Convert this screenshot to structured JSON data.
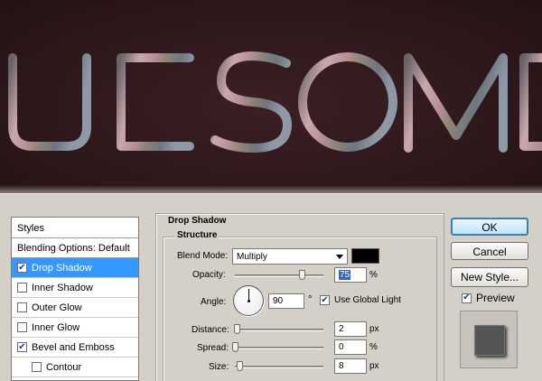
{
  "canvas": {
    "word": "WESOME"
  },
  "styles_panel": {
    "header": "Styles",
    "items": [
      {
        "label": "Blending Options: Default",
        "checkbox": false,
        "checked": false,
        "selected": false
      },
      {
        "label": "Drop Shadow",
        "checkbox": true,
        "checked": true,
        "selected": true
      },
      {
        "label": "Inner Shadow",
        "checkbox": true,
        "checked": false,
        "selected": false
      },
      {
        "label": "Outer Glow",
        "checkbox": true,
        "checked": false,
        "selected": false
      },
      {
        "label": "Inner Glow",
        "checkbox": true,
        "checked": false,
        "selected": false
      },
      {
        "label": "Bevel and Emboss",
        "checkbox": true,
        "checked": true,
        "selected": false
      },
      {
        "label": "Contour",
        "checkbox": true,
        "checked": false,
        "selected": false
      }
    ]
  },
  "drop_shadow": {
    "title": "Drop Shadow",
    "structure_title": "Structure",
    "blend_mode": {
      "label": "Blend Mode:",
      "value": "Multiply",
      "color": "#000000"
    },
    "opacity": {
      "label": "Opacity:",
      "value": "75",
      "unit": "%",
      "slider_fraction": 0.75
    },
    "angle": {
      "label": "Angle:",
      "value": "90",
      "unit": "°",
      "use_global_light_label": "Use Global Light",
      "use_global_light": true
    },
    "distance": {
      "label": "Distance:",
      "value": "2",
      "unit": "px",
      "slider_fraction": 0.0
    },
    "spread": {
      "label": "Spread:",
      "value": "0",
      "unit": "%",
      "slider_fraction": 0.0
    },
    "size": {
      "label": "Size:",
      "value": "8",
      "unit": "px",
      "slider_fraction": 0.05
    }
  },
  "buttons": {
    "ok": "OK",
    "cancel": "Cancel",
    "new_style": "New Style...",
    "preview_label": "Preview",
    "preview_checked": true
  }
}
